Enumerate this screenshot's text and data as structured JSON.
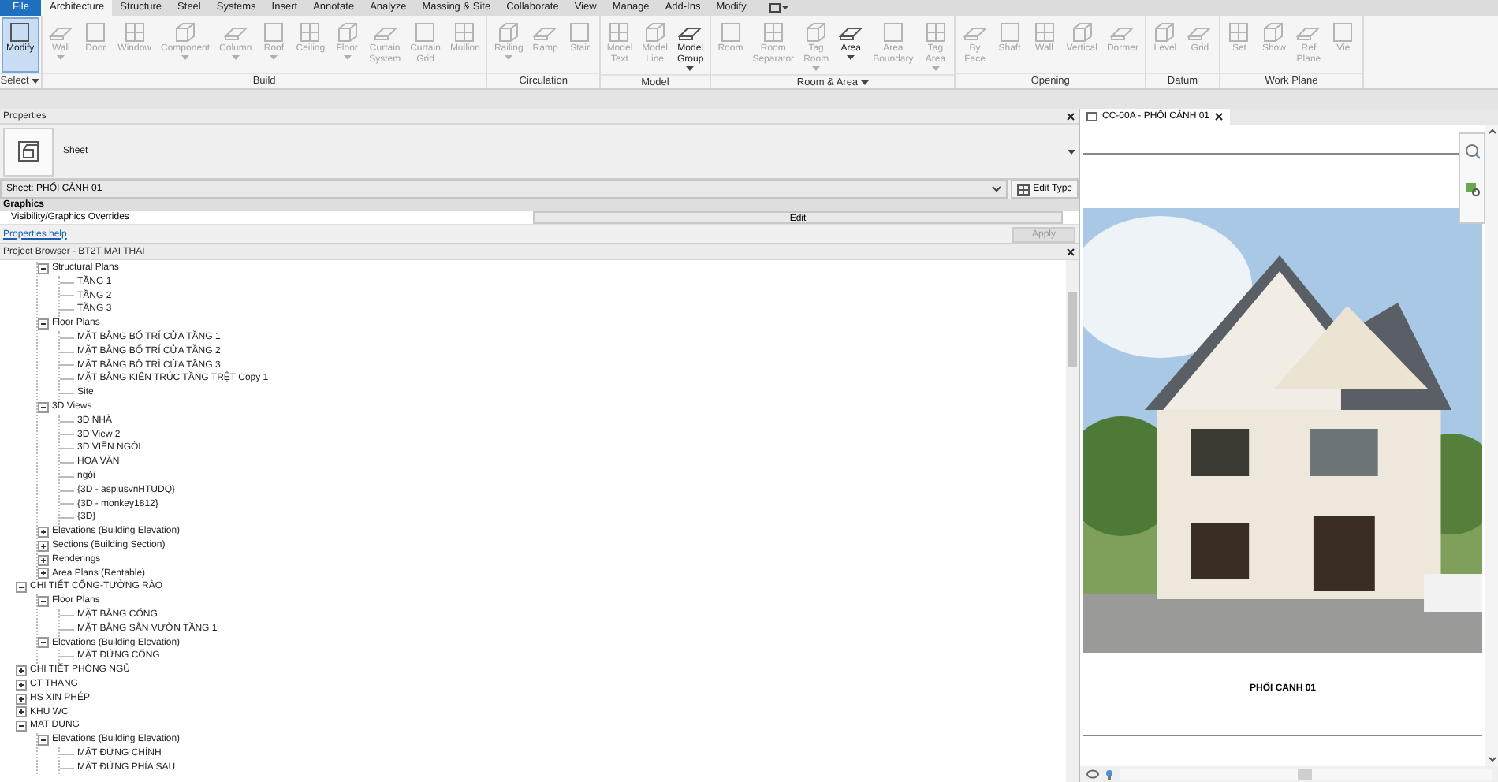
{
  "ribbon_tabs": [
    {
      "label": "File",
      "kind": "file",
      "selected": false
    },
    {
      "label": "Architecture",
      "kind": "tab",
      "selected": true
    },
    {
      "label": "Structure",
      "kind": "tab",
      "selected": false
    },
    {
      "label": "Steel",
      "kind": "tab",
      "selected": false
    },
    {
      "label": "Systems",
      "kind": "tab",
      "selected": false
    },
    {
      "label": "Insert",
      "kind": "tab",
      "selected": false
    },
    {
      "label": "Annotate",
      "kind": "tab",
      "selected": false
    },
    {
      "label": "Analyze",
      "kind": "tab",
      "selected": false
    },
    {
      "label": "Massing & Site",
      "kind": "tab",
      "selected": false
    },
    {
      "label": "Collaborate",
      "kind": "tab",
      "selected": false
    },
    {
      "label": "View",
      "kind": "tab",
      "selected": false
    },
    {
      "label": "Manage",
      "kind": "tab",
      "selected": false
    },
    {
      "label": "Add-Ins",
      "kind": "tab",
      "selected": false
    },
    {
      "label": "Modify",
      "kind": "tab",
      "selected": false
    }
  ],
  "ribbon_panels": [
    {
      "title": "Select",
      "menu": true,
      "tools": [
        {
          "lines": [
            "Modify"
          ],
          "dropdown": false,
          "disabled": false,
          "selected": true
        }
      ]
    },
    {
      "title": "Build",
      "menu": false,
      "tools": [
        {
          "lines": [
            "Wall"
          ],
          "dropdown": true,
          "disabled": true,
          "selected": false
        },
        {
          "lines": [
            "Door"
          ],
          "dropdown": false,
          "disabled": true,
          "selected": false
        },
        {
          "lines": [
            "Window"
          ],
          "dropdown": false,
          "disabled": true,
          "selected": false
        },
        {
          "lines": [
            "Component"
          ],
          "dropdown": true,
          "disabled": true,
          "selected": false
        },
        {
          "lines": [
            "Column"
          ],
          "dropdown": true,
          "disabled": true,
          "selected": false
        },
        {
          "lines": [
            "Roof"
          ],
          "dropdown": true,
          "disabled": true,
          "selected": false
        },
        {
          "lines": [
            "Ceiling"
          ],
          "dropdown": false,
          "disabled": true,
          "selected": false
        },
        {
          "lines": [
            "Floor"
          ],
          "dropdown": true,
          "disabled": true,
          "selected": false
        },
        {
          "lines": [
            "Curtain",
            "System"
          ],
          "dropdown": false,
          "disabled": true,
          "selected": false
        },
        {
          "lines": [
            "Curtain",
            "Grid"
          ],
          "dropdown": false,
          "disabled": true,
          "selected": false
        },
        {
          "lines": [
            "Mullion"
          ],
          "dropdown": false,
          "disabled": true,
          "selected": false
        }
      ]
    },
    {
      "title": "Circulation",
      "menu": false,
      "tools": [
        {
          "lines": [
            "Railing"
          ],
          "dropdown": true,
          "disabled": true,
          "selected": false
        },
        {
          "lines": [
            "Ramp"
          ],
          "dropdown": false,
          "disabled": true,
          "selected": false
        },
        {
          "lines": [
            "Stair"
          ],
          "dropdown": false,
          "disabled": true,
          "selected": false
        }
      ]
    },
    {
      "title": "Model",
      "menu": false,
      "tools": [
        {
          "lines": [
            "Model",
            "Text"
          ],
          "dropdown": false,
          "disabled": true,
          "selected": false
        },
        {
          "lines": [
            "Model",
            "Line"
          ],
          "dropdown": false,
          "disabled": true,
          "selected": false
        },
        {
          "lines": [
            "Model",
            "Group"
          ],
          "dropdown": true,
          "disabled": false,
          "selected": false
        }
      ]
    },
    {
      "title": "Room & Area",
      "menu": true,
      "tools": [
        {
          "lines": [
            "Room"
          ],
          "dropdown": false,
          "disabled": true,
          "selected": false
        },
        {
          "lines": [
            "Room",
            "Separator"
          ],
          "dropdown": false,
          "disabled": true,
          "selected": false
        },
        {
          "lines": [
            "Tag",
            "Room"
          ],
          "dropdown": true,
          "disabled": true,
          "selected": false
        },
        {
          "lines": [
            "Area"
          ],
          "dropdown": true,
          "disabled": false,
          "selected": false
        },
        {
          "lines": [
            "Area",
            "Boundary"
          ],
          "dropdown": false,
          "disabled": true,
          "selected": false
        },
        {
          "lines": [
            "Tag",
            "Area"
          ],
          "dropdown": true,
          "disabled": true,
          "selected": false
        }
      ]
    },
    {
      "title": "Opening",
      "menu": false,
      "tools": [
        {
          "lines": [
            "By",
            "Face"
          ],
          "dropdown": false,
          "disabled": true,
          "selected": false
        },
        {
          "lines": [
            "Shaft"
          ],
          "dropdown": false,
          "disabled": true,
          "selected": false
        },
        {
          "lines": [
            "Wall"
          ],
          "dropdown": false,
          "disabled": true,
          "selected": false
        },
        {
          "lines": [
            "Vertical"
          ],
          "dropdown": false,
          "disabled": true,
          "selected": false
        },
        {
          "lines": [
            "Dormer"
          ],
          "dropdown": false,
          "disabled": true,
          "selected": false
        }
      ]
    },
    {
      "title": "Datum",
      "menu": false,
      "tools": [
        {
          "lines": [
            "Level"
          ],
          "dropdown": false,
          "disabled": true,
          "selected": false
        },
        {
          "lines": [
            "Grid"
          ],
          "dropdown": false,
          "disabled": true,
          "selected": false
        }
      ]
    },
    {
      "title": "Work Plane",
      "menu": false,
      "tools": [
        {
          "lines": [
            "Set"
          ],
          "dropdown": false,
          "disabled": true,
          "selected": false
        },
        {
          "lines": [
            "Show"
          ],
          "dropdown": false,
          "disabled": true,
          "selected": false
        },
        {
          "lines": [
            "Ref",
            "Plane"
          ],
          "dropdown": false,
          "disabled": true,
          "selected": false
        },
        {
          "lines": [
            "Vie"
          ],
          "dropdown": false,
          "disabled": true,
          "selected": false
        }
      ]
    }
  ],
  "properties": {
    "title": "Properties",
    "type_name": "Sheet",
    "instance": "Sheet: PHỐI CẢNH 01",
    "edit_type": "Edit Type",
    "group": "Graphics",
    "params": [
      {
        "name": "Visibility/Graphics Overrides",
        "value": "Edit"
      }
    ],
    "help_link": "Properties help",
    "apply": {
      "label": "Apply",
      "disabled": true
    }
  },
  "project_browser": {
    "title": "Project Browser - BT2T MAI THAI",
    "tree": [
      {
        "children": [
          {
            "label": "Structural Plans",
            "expanded": true,
            "children": [
              {
                "label": "TẦNG 1"
              },
              {
                "label": "TẦNG 2"
              },
              {
                "label": "TẦNG 3"
              }
            ]
          },
          {
            "label": "Floor Plans",
            "expanded": true,
            "children": [
              {
                "label": "MẶT BẰNG BỐ TRÍ CỬA TẦNG 1"
              },
              {
                "label": "MẶT BẰNG BỐ TRÍ CỬA TẦNG 2"
              },
              {
                "label": "MẶT BẰNG BỐ TRÍ CỬA TẦNG 3"
              },
              {
                "label": "MẶT BẰNG KIẾN TRÚC TẦNG TRỆT Copy 1"
              },
              {
                "label": "Site"
              }
            ]
          },
          {
            "label": "3D Views",
            "expanded": true,
            "children": [
              {
                "label": "3D NHÀ"
              },
              {
                "label": "3D View 2"
              },
              {
                "label": "3D VIÊN NGÓI"
              },
              {
                "label": "HOA VĂN"
              },
              {
                "label": "ngói"
              },
              {
                "label": "{3D - asplusvnHTUDQ}"
              },
              {
                "label": "{3D - monkey1812}"
              },
              {
                "label": "{3D}"
              }
            ]
          },
          {
            "label": "Elevations (Building Elevation)",
            "expanded": false
          },
          {
            "label": "Sections (Building Section)",
            "expanded": false
          },
          {
            "label": "Renderings",
            "expanded": false
          },
          {
            "label": "Area Plans (Rentable)",
            "expanded": false
          }
        ]
      },
      {
        "label": "CHI TIẾT CỔNG-TƯỜNG RÀO",
        "expanded": true,
        "children": [
          {
            "label": "Floor Plans",
            "expanded": true,
            "children": [
              {
                "label": "MẶT BẰNG CỔNG"
              },
              {
                "label": "MẶT BẰNG SÂN VƯỜN TẦNG 1"
              }
            ]
          },
          {
            "label": "Elevations (Building Elevation)",
            "expanded": true,
            "children": [
              {
                "label": "MẶT ĐỨNG CỔNG"
              }
            ]
          }
        ]
      },
      {
        "label": "CHI TIẾT PHÒNG NGỦ",
        "expanded": false
      },
      {
        "label": "CT THANG",
        "expanded": false
      },
      {
        "label": "HS XIN PHÉP",
        "expanded": false
      },
      {
        "label": "KHU WC",
        "expanded": false
      },
      {
        "label": "MAT DUNG",
        "expanded": true,
        "children": [
          {
            "label": "Elevations (Building Elevation)",
            "expanded": true,
            "children": [
              {
                "label": "MẶT ĐỨNG CHÍNH"
              },
              {
                "label": "MẶT ĐỨNG PHÍA SAU"
              }
            ]
          }
        ]
      }
    ]
  },
  "view": {
    "tab": "CC-00A - PHỐI CẢNH 01",
    "caption": "PHỐI CANH 01"
  }
}
